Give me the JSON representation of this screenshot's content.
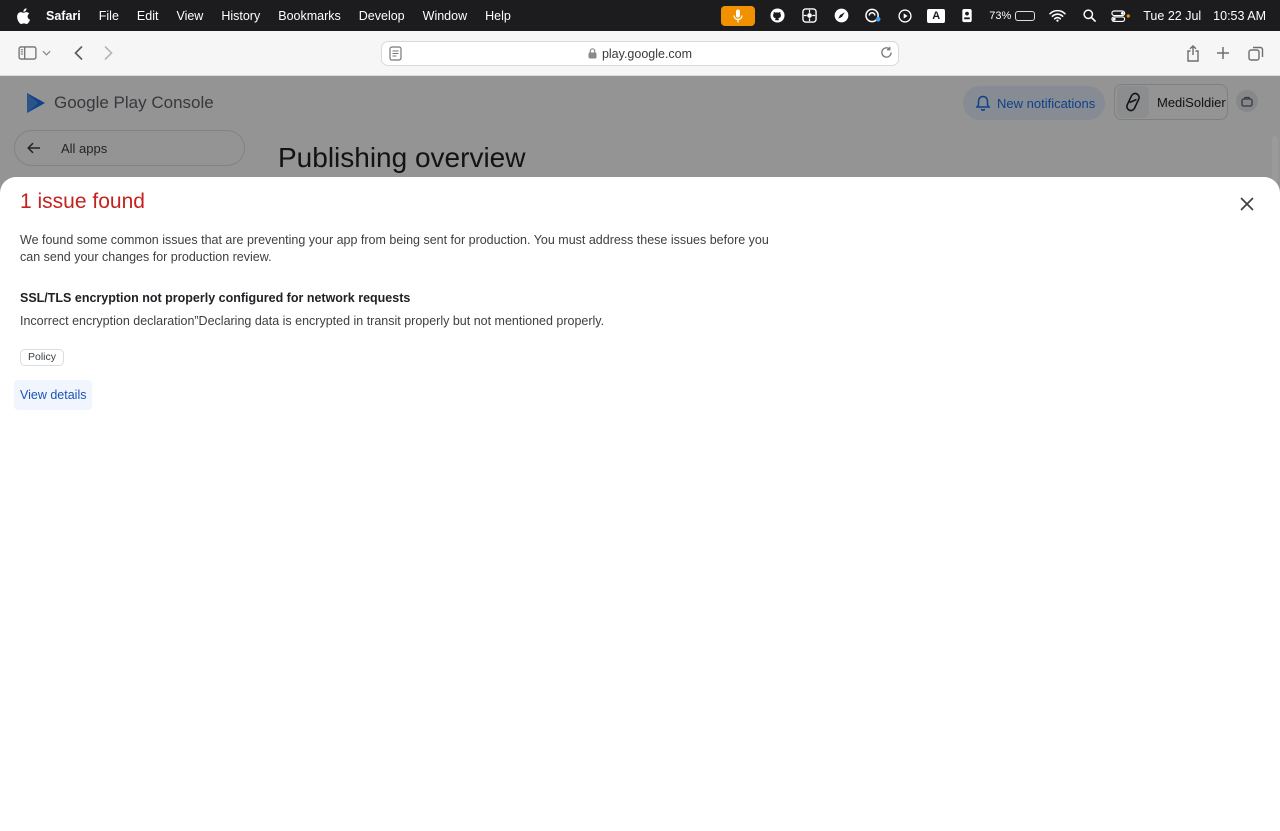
{
  "menubar": {
    "app_name": "Safari",
    "items": [
      "File",
      "Edit",
      "View",
      "History",
      "Bookmarks",
      "Develop",
      "Window",
      "Help"
    ],
    "battery_percent": "73%",
    "battery_level": 0.73,
    "date": "Tue 22 Jul",
    "time": "10:53 AM",
    "input_indicator": "A"
  },
  "browser": {
    "url": "play.google.com"
  },
  "background_page": {
    "logo_text": "Google Play Console",
    "notifications_label": "New notifications",
    "developer_name": "MediSoldier",
    "all_apps_label": "All apps",
    "page_title": "Publishing overview"
  },
  "dialog": {
    "title": "1 issue found",
    "description": "We found some common issues that are preventing your app from being sent for production. You must address these issues before you can send your changes for production review.",
    "issue": {
      "title": "SSL/TLS encryption not properly configured for network requests",
      "description": "Incorrect encryption declaration”Declaring data is encrypted in transit properly but not mentioned properly.",
      "tag": "Policy"
    },
    "view_details_label": "View details"
  },
  "colors": {
    "error_title": "#c5221f",
    "link": "#1a55b5",
    "accent_blue": "#1a73e8"
  }
}
